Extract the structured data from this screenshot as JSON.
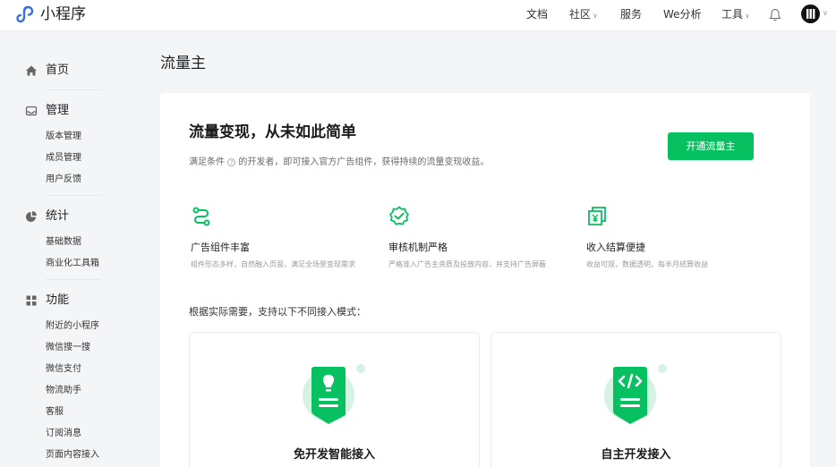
{
  "app": {
    "name": "小程序"
  },
  "topnav": {
    "items": [
      {
        "label": "文档",
        "dropdown": false
      },
      {
        "label": "社区",
        "dropdown": true
      },
      {
        "label": "服务",
        "dropdown": false
      },
      {
        "label": "We分析",
        "dropdown": false
      },
      {
        "label": "工具",
        "dropdown": true
      }
    ],
    "icons": [
      "bell-icon",
      "avatar"
    ]
  },
  "sidebar": {
    "home": {
      "label": "首页",
      "icon": "home-icon"
    },
    "manage": {
      "label": "管理",
      "icon": "inbox-icon",
      "items": [
        "版本管理",
        "成员管理",
        "用户反馈"
      ]
    },
    "stats": {
      "label": "统计",
      "icon": "pie-chart-icon",
      "items": [
        "基础数据",
        "商业化工具箱"
      ]
    },
    "features": {
      "label": "功能",
      "icon": "grid-icon",
      "items": [
        "附近的小程序",
        "微信搜一搜",
        "微信支付",
        "物流助手",
        "客服",
        "订阅消息",
        "页面内容接入"
      ]
    }
  },
  "main": {
    "page_title": "流量主",
    "hero": {
      "title": "流量变现，从未如此简单",
      "desc_before": "满足条件",
      "desc_after": "的开发者，即可接入官方广告组件，获得持续的流量变现收益。",
      "button": "开通流量主"
    },
    "features": [
      {
        "title": "广告组件丰富",
        "desc": "组件形态多样，自然融入页面，满足全场景变现需求",
        "icon": "route-icon"
      },
      {
        "title": "审核机制严格",
        "desc": "严格准入广告主资质及投放内容，并支持广告屏蔽",
        "icon": "verified-badge-icon"
      },
      {
        "title": "收入结算便捷",
        "desc": "收益可观，数据透明，每半月结算收益",
        "icon": "yuan-cards-icon"
      }
    ],
    "modes_intro": "根据实际需要，支持以下不同接入模式：",
    "modes": [
      {
        "title": "免开发智能接入",
        "icon": "lightbulb-doc-icon"
      },
      {
        "title": "自主开发接入",
        "icon": "code-doc-icon"
      }
    ]
  },
  "colors": {
    "accent": "#07c160",
    "accent_light": "#d4f3e2",
    "background": "#f4f5f7"
  }
}
